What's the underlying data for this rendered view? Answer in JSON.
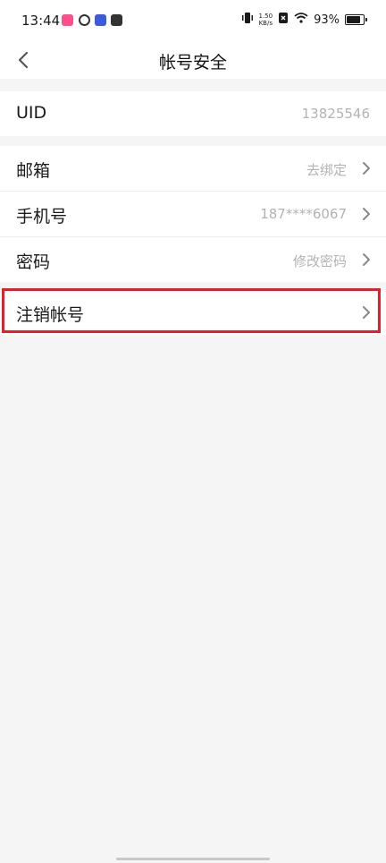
{
  "status_bar": {
    "time": "13:44",
    "net_speed_value": "1.50",
    "net_speed_unit": "KB/s",
    "battery": "93%",
    "battery_level": 0.93,
    "app_icons": [
      "music-app-icon",
      "browser-app-icon",
      "calendar-app-icon",
      "message-app-icon"
    ]
  },
  "nav": {
    "title": "帐号安全"
  },
  "uid": {
    "label": "UID",
    "value": "13825546"
  },
  "rows": [
    {
      "label": "邮箱",
      "value": "去绑定"
    },
    {
      "label": "手机号",
      "value": "187****6067"
    },
    {
      "label": "密码",
      "value": "修改密码"
    }
  ],
  "delete_account": {
    "label": "注销帐号"
  },
  "colors": {
    "highlight": "#e0202a",
    "background": "#f5f5f5",
    "secondary_text": "#b3b3b3"
  }
}
